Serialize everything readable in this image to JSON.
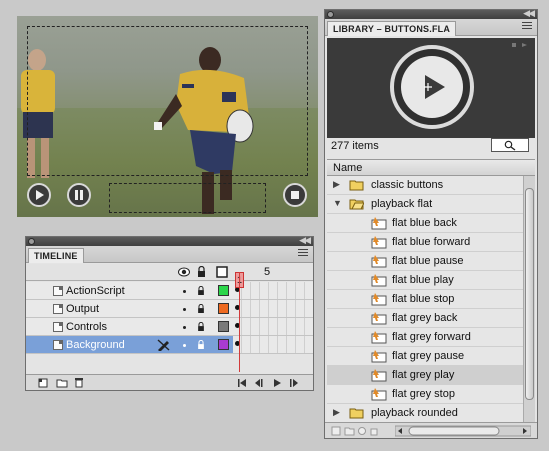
{
  "timeline": {
    "tab": "TIMELINE",
    "frame_marker": "1",
    "frame_label_5": "5",
    "layers": [
      {
        "name": "ActionScript",
        "color": "#2bd64a"
      },
      {
        "name": "Output",
        "color": "#ee6a21"
      },
      {
        "name": "Controls",
        "color": "#7a7a7a"
      },
      {
        "name": "Background",
        "color": "#a83bd0"
      }
    ]
  },
  "library": {
    "tab": "LIBRARY – BUTTONS.FLA",
    "item_count": "277 items",
    "column_name": "Name",
    "items": [
      {
        "label": "classic buttons",
        "kind": "folder",
        "expanded": false
      },
      {
        "label": "playback flat",
        "kind": "folder",
        "expanded": true
      },
      {
        "label": "flat blue back",
        "kind": "symbol"
      },
      {
        "label": "flat blue forward",
        "kind": "symbol"
      },
      {
        "label": "flat blue pause",
        "kind": "symbol"
      },
      {
        "label": "flat blue play",
        "kind": "symbol"
      },
      {
        "label": "flat blue stop",
        "kind": "symbol"
      },
      {
        "label": "flat grey back",
        "kind": "symbol"
      },
      {
        "label": "flat grey forward",
        "kind": "symbol"
      },
      {
        "label": "flat grey pause",
        "kind": "symbol"
      },
      {
        "label": "flat grey play",
        "kind": "symbol",
        "selected": true
      },
      {
        "label": "flat grey stop",
        "kind": "symbol"
      },
      {
        "label": "playback rounded",
        "kind": "folder",
        "expanded": false
      }
    ]
  }
}
